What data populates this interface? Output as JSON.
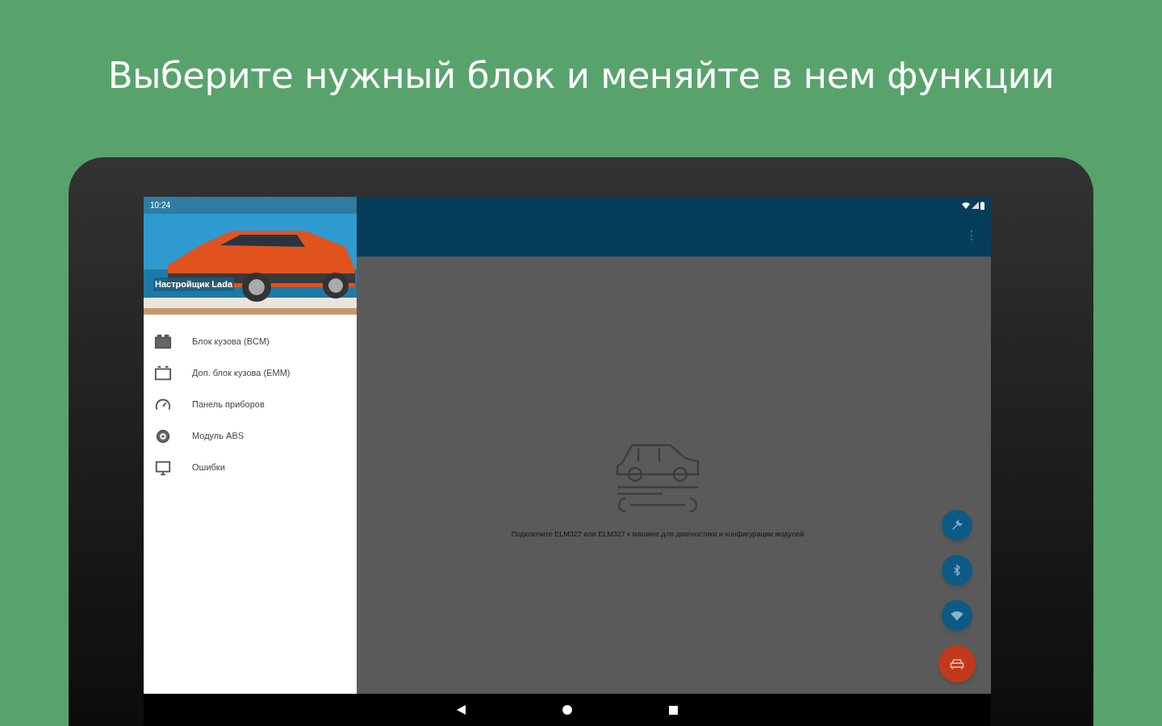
{
  "headline": "Выберите нужный блок и меняйте в нем функции",
  "status_bar": {
    "time": "10:24"
  },
  "drawer": {
    "title": "Настройщик Lada",
    "items": [
      {
        "label": "Блок кузова (BCM)",
        "kind": "module"
      },
      {
        "label": "Доп. блок кузова (EMM)",
        "kind": "module-outline"
      },
      {
        "label": "Панель приборов",
        "kind": "gauge"
      },
      {
        "label": "Модуль ABS",
        "kind": "gear"
      },
      {
        "label": "Ошибки",
        "kind": "monitor"
      }
    ]
  },
  "main": {
    "message": "Подключите ELM327 или ELM327 к машине для диагностики и конфигурации модулей"
  },
  "fabs": [
    {
      "kind": "tools",
      "color": "#0d5a86"
    },
    {
      "kind": "bluetooth",
      "color": "#0d5a86"
    },
    {
      "kind": "wifi",
      "color": "#0d5a86"
    },
    {
      "kind": "car",
      "color": "#c2381a"
    }
  ]
}
